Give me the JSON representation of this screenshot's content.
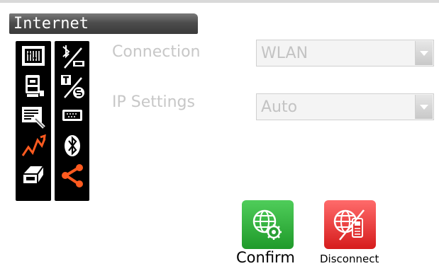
{
  "window": {
    "title": "Internet"
  },
  "form": {
    "connection": {
      "label": "Connection",
      "value": "WLAN"
    },
    "ip_settings": {
      "label": "IP Settings",
      "value": "Auto"
    }
  },
  "toolbar_icons": {
    "left": [
      "data-transfer-icon",
      "instrument-icon",
      "keyboard-icon",
      "graph-icon",
      "printer-icon"
    ],
    "right": [
      "bluetooth-usb-icon",
      "ts-switch-icon",
      "serial-port-icon",
      "bluetooth-icon",
      "share-icon"
    ]
  },
  "actions": {
    "confirm_label": "Confirm",
    "disconnect_label": "Disconnect"
  },
  "colors": {
    "title_bar": "#4d4d4d",
    "confirm_green": "#2ea83a",
    "disconnect_red": "#e83232",
    "disabled_text": "#c7c7c7"
  }
}
